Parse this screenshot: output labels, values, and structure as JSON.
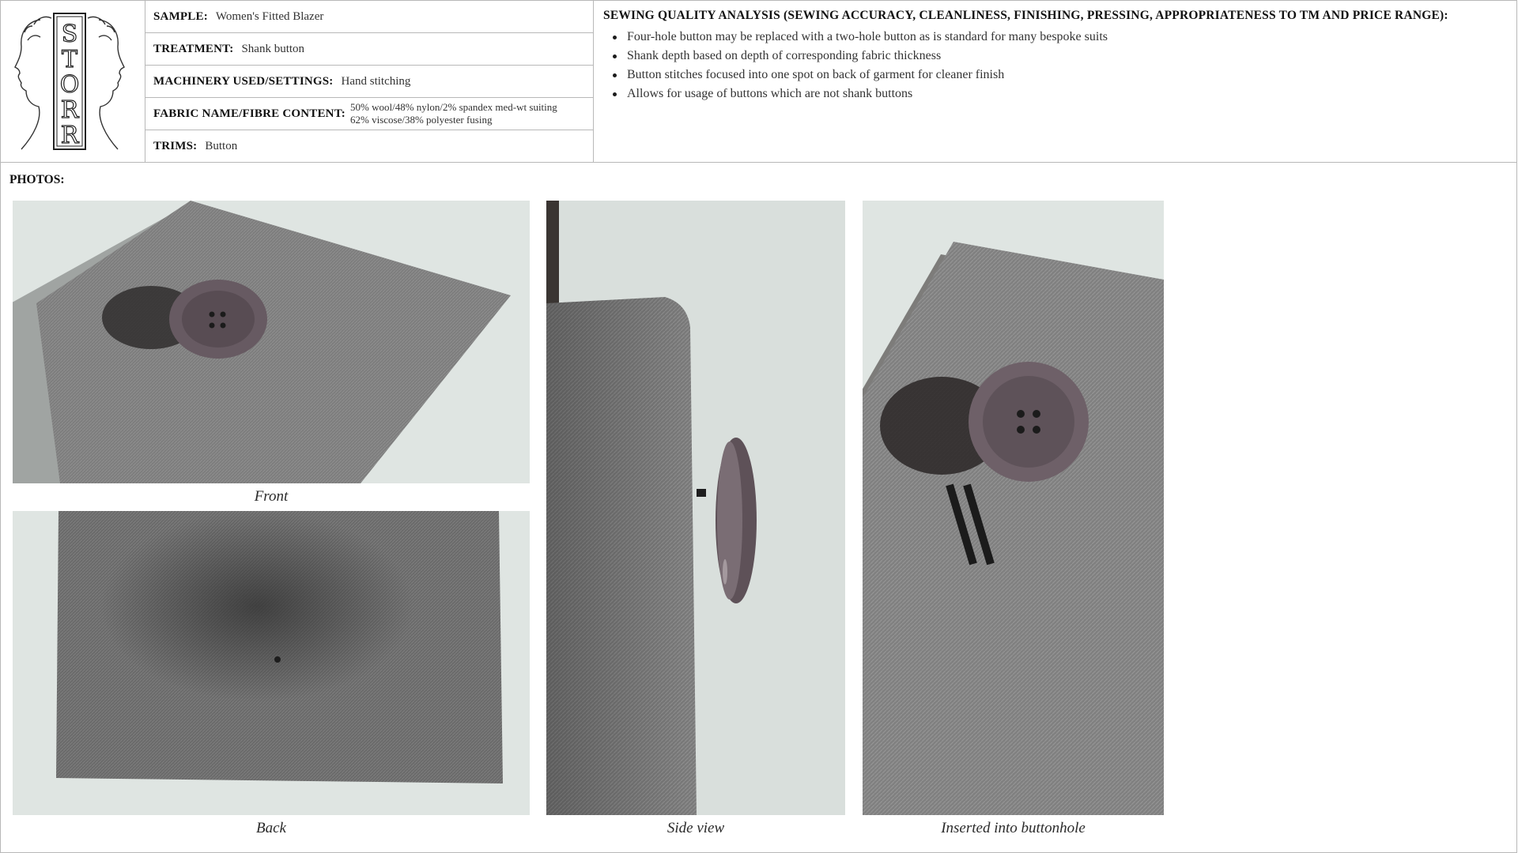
{
  "logo": {
    "text": "STORR",
    "label": "brand-logo"
  },
  "specs": {
    "sample": {
      "label": "SAMPLE:",
      "value": "Women's Fitted Blazer"
    },
    "treatment": {
      "label": "TREATMENT:",
      "value": "Shank button"
    },
    "machinery": {
      "label": "MACHINERY USED/SETTINGS:",
      "value": "Hand stitching"
    },
    "fabric": {
      "label": "FABRIC NAME/FIBRE CONTENT:",
      "line1": "50% wool/48% nylon/2% spandex med-wt suiting",
      "line2": "62% viscose/38% polyester fusing"
    },
    "trims": {
      "label": "TRIMS:",
      "value": "Button"
    }
  },
  "analysis": {
    "title": "SEWING QUALITY ANALYSIS (SEWING ACCURACY, CLEANLINESS, FINISHING, PRESSING, APPROPRIATENESS TO TM AND PRICE RANGE):",
    "items": [
      "Four-hole button may be replaced with a two-hole button as is standard for many bespoke suits",
      "Shank depth based on depth of corresponding fabric thickness",
      "Button stitches focused into one spot on back of garment for cleaner finish",
      "Allows for usage of buttons which are not shank buttons"
    ]
  },
  "photos": {
    "label": "PHOTOS:",
    "captions": {
      "front": "Front",
      "back": "Back",
      "side": "Side view",
      "buttonhole": "Inserted into buttonhole"
    }
  },
  "colors": {
    "fabric": "#7a7a7a",
    "button": "#6e6068",
    "background": "#dce2df",
    "border": "#b8b8b8"
  }
}
